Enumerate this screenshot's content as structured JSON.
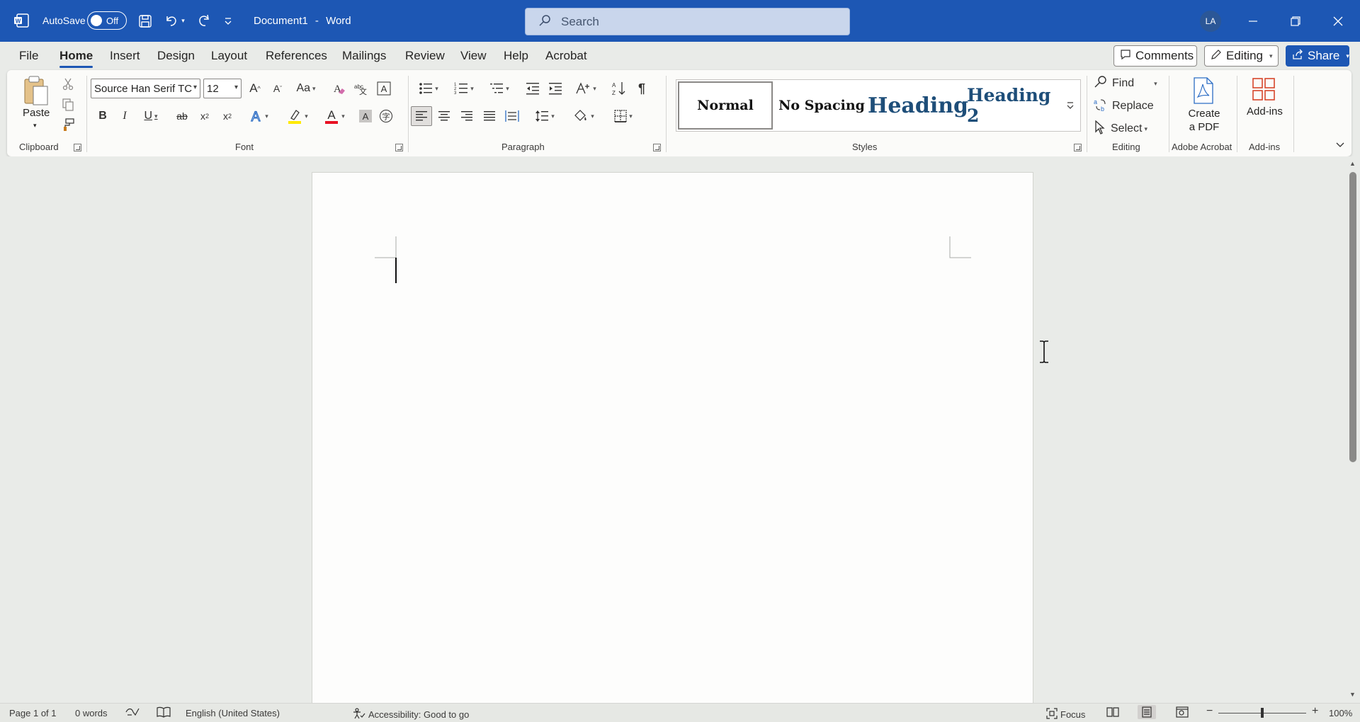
{
  "titlebar": {
    "autosave_label": "AutoSave",
    "autosave_state": "Off",
    "document_name": "Document1",
    "separator": "-",
    "app_name": "Word",
    "search_placeholder": "Search",
    "avatar_initials": "LA",
    "color": "#1d57b4"
  },
  "tabs": [
    "File",
    "Home",
    "Insert",
    "Design",
    "Layout",
    "References",
    "Mailings",
    "Review",
    "View",
    "Help",
    "Acrobat"
  ],
  "active_tab": "Home",
  "top_buttons": {
    "comments": "Comments",
    "editing": "Editing",
    "share": "Share"
  },
  "ribbon": {
    "clipboard": {
      "paste": "Paste",
      "label": "Clipboard"
    },
    "font": {
      "name": "Source Han Serif TC",
      "size": "12",
      "label": "Font"
    },
    "paragraph": {
      "label": "Paragraph"
    },
    "styles": {
      "items": [
        "Normal",
        "No Spacing",
        "Heading",
        "Heading 2"
      ],
      "label": "Styles"
    },
    "editing": {
      "find": "Find",
      "replace": "Replace",
      "select": "Select",
      "label": "Editing"
    },
    "acrobat": {
      "create_line1": "Create",
      "create_line2": "a PDF",
      "label": "Adobe Acrobat"
    },
    "addins": {
      "button": "Add-ins",
      "label": "Add-ins"
    }
  },
  "statusbar": {
    "page": "Page 1 of 1",
    "words": "0 words",
    "language": "English (United States)",
    "accessibility": "Accessibility: Good to go",
    "focus": "Focus",
    "zoom": "100%"
  },
  "icons": [
    "word-logo-icon",
    "save-icon",
    "undo-icon",
    "redo-icon",
    "customize-qat-icon",
    "search-icon",
    "minimize-icon",
    "restore-icon",
    "close-icon",
    "comment-icon",
    "pencil-icon",
    "share-icon",
    "paste-icon",
    "cut-icon",
    "copy-icon",
    "format-painter-icon",
    "find-icon",
    "replace-icon",
    "select-icon",
    "create-pdf-icon",
    "add-ins-icon"
  ]
}
